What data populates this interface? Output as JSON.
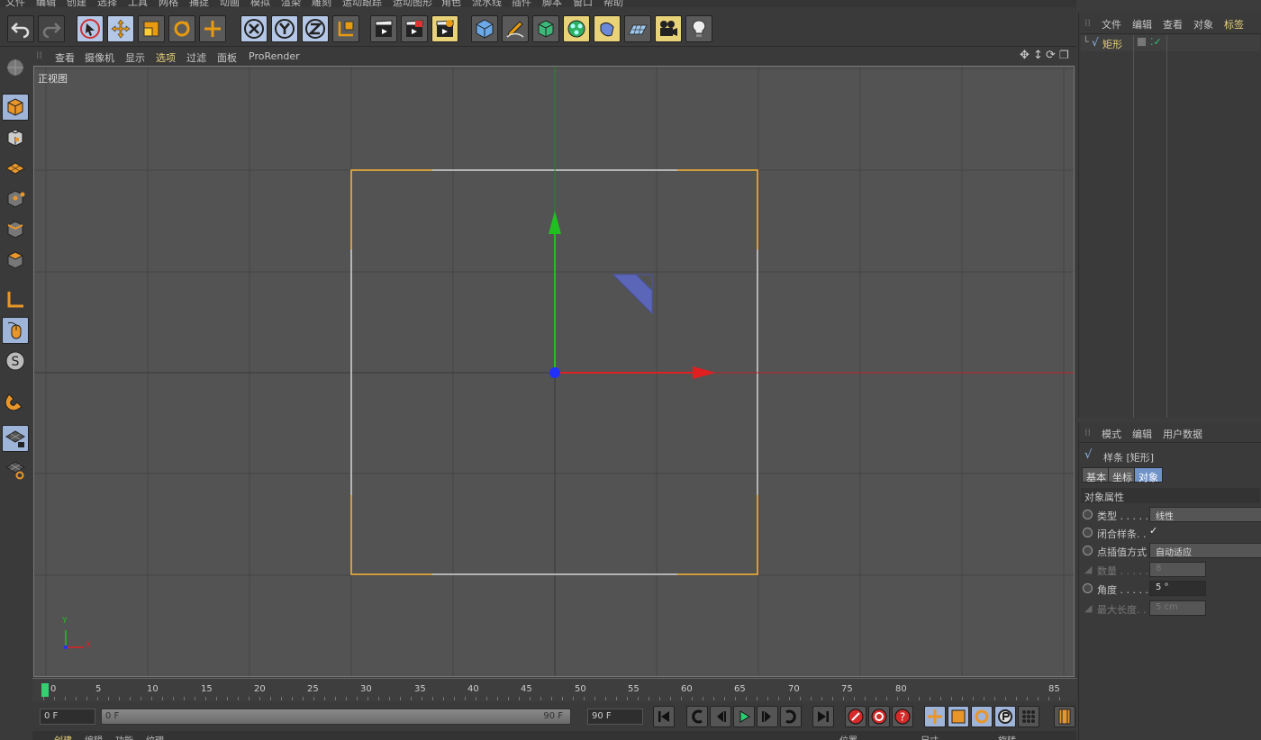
{
  "menubar": [
    "文件",
    "编辑",
    "创建",
    "选择",
    "工具",
    "网格",
    "捕捉",
    "动画",
    "模拟",
    "渲染",
    "雕刻",
    "运动跟踪",
    "运动图形",
    "角色",
    "流水线",
    "插件",
    "脚本",
    "窗口",
    "帮助"
  ],
  "viewport_menu": [
    "查看",
    "摄像机",
    "显示",
    "选项",
    "过滤",
    "面板",
    "ProRender"
  ],
  "viewport_label": "正视图",
  "axis_labels": {
    "y": "Y",
    "x": "X"
  },
  "timeline_ticks": [
    "0",
    "5",
    "10",
    "15",
    "20",
    "25",
    "30",
    "35",
    "40",
    "45",
    "50",
    "55",
    "60",
    "65",
    "70",
    "75",
    "80",
    "85"
  ],
  "transport": {
    "current_frame": "0 F",
    "range_start": "0 F",
    "range_end": "90 F",
    "end_frame": "90 F"
  },
  "bottom_strip": [
    "创建",
    "编辑",
    "功能",
    "纹理",
    "位置",
    "尺寸",
    "旋转"
  ],
  "object_manager": {
    "menu": [
      "文件",
      "编辑",
      "查看",
      "对象",
      "标签"
    ],
    "object_name": "矩形"
  },
  "attribute_manager": {
    "menu": [
      "模式",
      "编辑",
      "用户数据"
    ],
    "object_title": "样条 [矩形]",
    "tabs": [
      "基本",
      "坐标",
      "对象"
    ],
    "section": "对象属性",
    "props": [
      {
        "label": "类型 . . . . .",
        "value": "线性"
      },
      {
        "label": "闭合样条. .",
        "value": "✓"
      },
      {
        "label": "点插值方式",
        "value": "自动适应"
      },
      {
        "label": "数量 . . . . .",
        "value": "8"
      },
      {
        "label": "角度 . . . . .",
        "value": "5 °"
      },
      {
        "label": "最大长度. .",
        "value": "5 cm"
      }
    ]
  },
  "colors": {
    "x_axis": "#e02020",
    "y_axis": "#20c020",
    "z_point": "#2030ff",
    "spline_corner": "#e8a020",
    "spline_edge": "#d8d8d8",
    "selected_tab": "#6f92c9"
  }
}
